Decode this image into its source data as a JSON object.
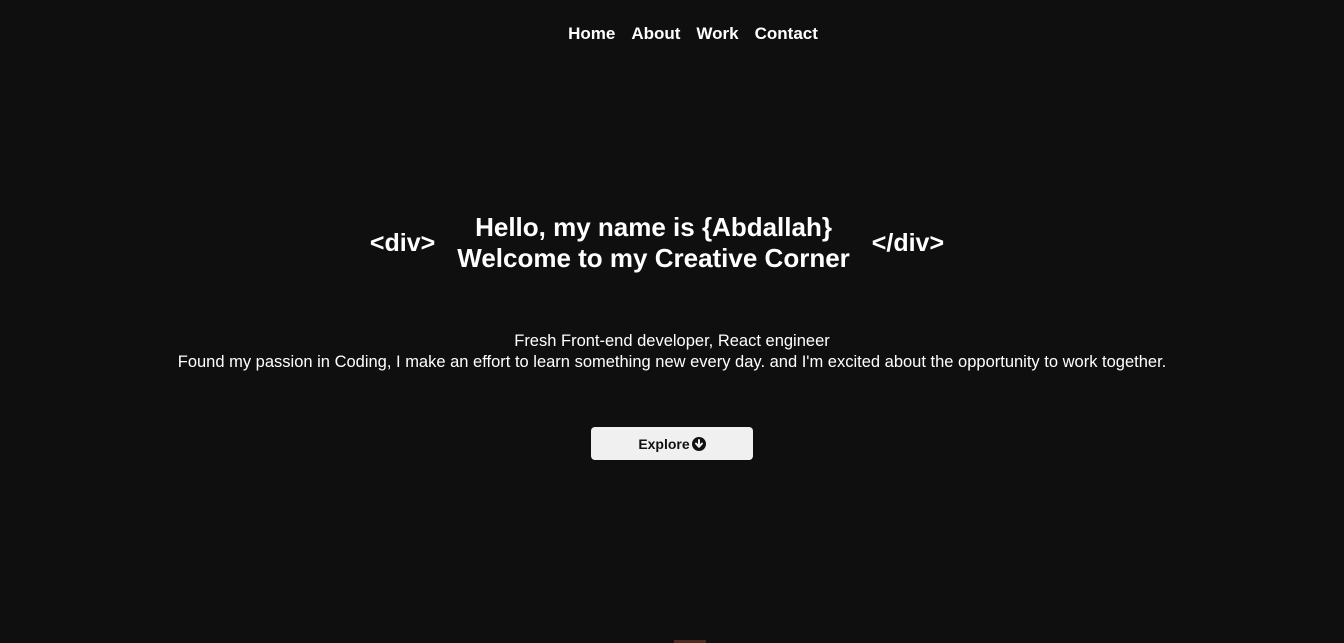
{
  "nav": {
    "items": [
      {
        "label": "Home"
      },
      {
        "label": "About"
      },
      {
        "label": "Work"
      },
      {
        "label": "Contact"
      }
    ]
  },
  "hero": {
    "open_tag": "<div>",
    "close_tag": "</div>",
    "headline_line1": "Hello, my name is {Abdallah}",
    "headline_line2": "Welcome to my Creative Corner"
  },
  "intro": {
    "line1": "Fresh Front-end developer, React engineer",
    "line2": "Found my passion in Coding, I make an effort to learn something new every day. and I'm excited about the opportunity to work together."
  },
  "explore_button": {
    "label": "Explore",
    "icon": "arrow-circle-down-icon"
  },
  "colors": {
    "background": "#0f0f0f",
    "text": "#ffffff",
    "button_background": "#f0f0f0",
    "button_text": "#111111"
  }
}
